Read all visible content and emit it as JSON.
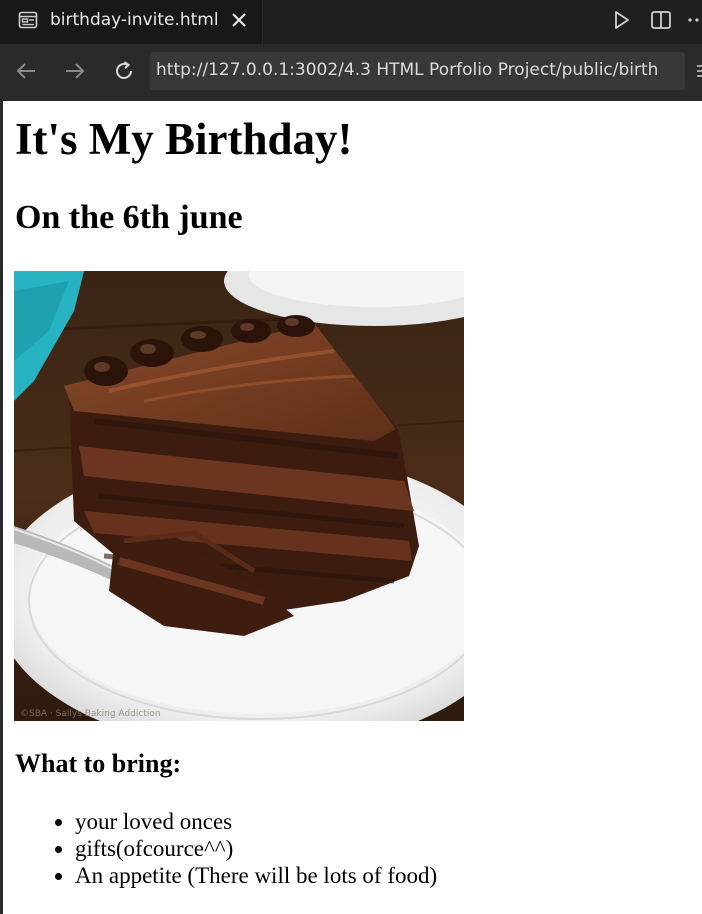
{
  "tab": {
    "title": "birthday-invite.html"
  },
  "address_bar": {
    "url": "http://127.0.0.1:3002/4.3 HTML Porfolio Project/public/birth"
  },
  "page": {
    "heading": "It's My Birthday!",
    "subheading": "On the 6th june",
    "cake_image": {
      "watermark": "©SBA · Sallys Baking Addiction"
    },
    "bring_heading": "What to bring:",
    "bring_items": [
      "your loved onces",
      "gifts(ofcource^^)",
      "An appetite (There will be lots of food)"
    ]
  }
}
